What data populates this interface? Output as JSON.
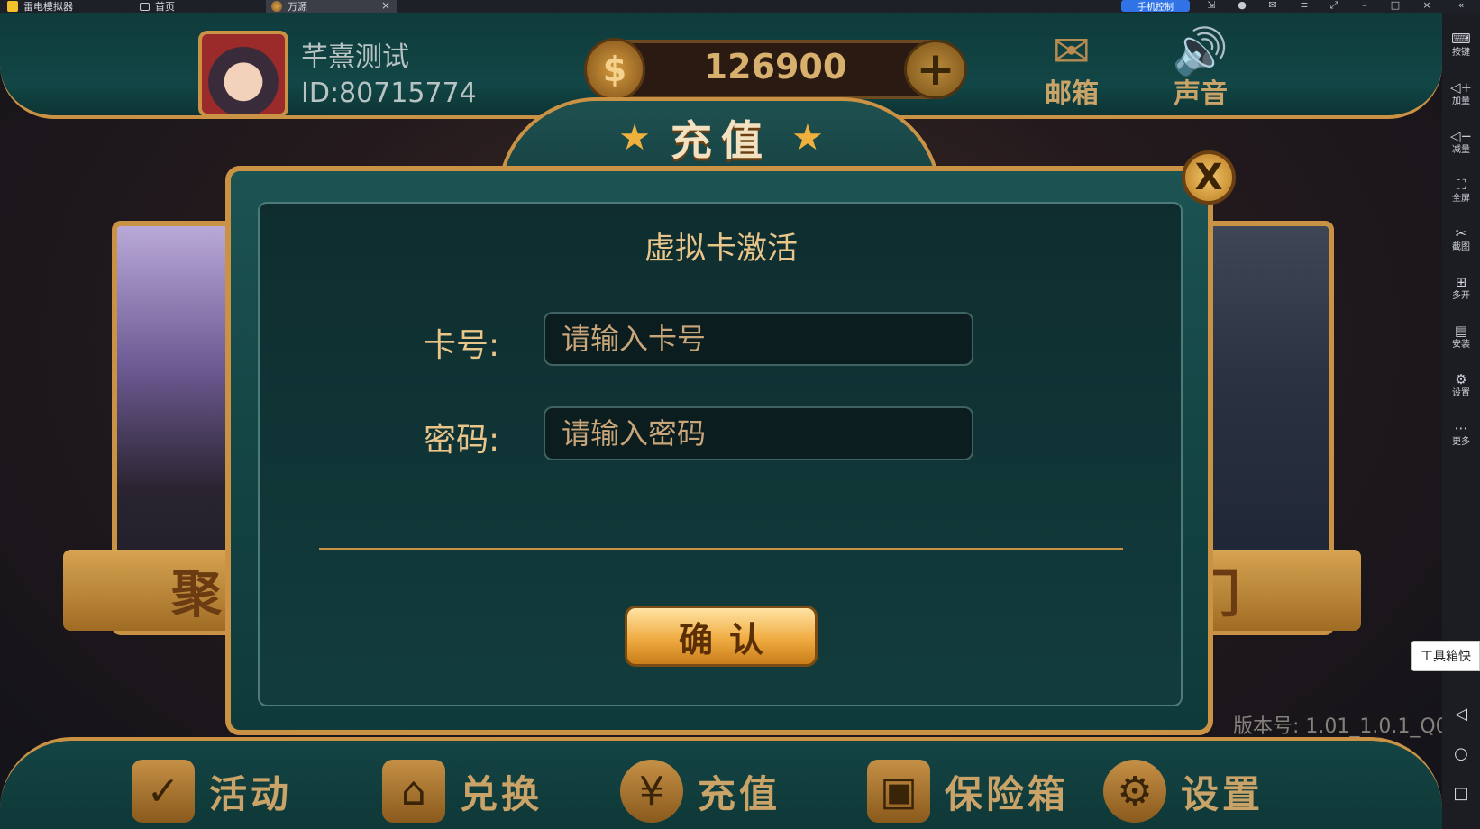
{
  "emulator": {
    "tabs": [
      {
        "label": "雷电模拟器",
        "icon": "emulator-logo-icon"
      },
      {
        "label": "首页",
        "icon": "home-icon"
      },
      {
        "label": "万源",
        "icon": "game-icon"
      }
    ],
    "phone_control": "手机控制",
    "toolbar": [
      {
        "label": "按键",
        "icon": "keyboard-icon"
      },
      {
        "label": "加量",
        "icon": "volume-up-icon"
      },
      {
        "label": "减量",
        "icon": "volume-down-icon"
      },
      {
        "label": "全屏",
        "icon": "fullscreen-icon"
      },
      {
        "label": "截图",
        "icon": "scissors-icon"
      },
      {
        "label": "多开",
        "icon": "multi-instance-icon"
      },
      {
        "label": "安装",
        "icon": "apk-icon"
      },
      {
        "label": "设置",
        "icon": "gear-icon"
      },
      {
        "label": "更多",
        "icon": "more-icon"
      }
    ],
    "toolbox_tip": "工具箱快"
  },
  "game": {
    "user": {
      "name": "芊熹测试",
      "id": "ID:80715774"
    },
    "coins": "126900",
    "top_buttons": {
      "mail": "邮箱",
      "sound": "声音"
    },
    "dialog": {
      "title": "充值",
      "close_label": "X",
      "section_title": "虚拟卡激活",
      "card_label": "卡号:",
      "card_placeholder": "请输入卡号",
      "password_label": "密码:",
      "password_placeholder": "请输入密码",
      "confirm_label": "确认"
    },
    "ribbons": {
      "left": "聚",
      "right": "门"
    },
    "version": "版本号: 1.01_1.0.1_Q0",
    "bottom_nav": {
      "activity": "活动",
      "exchange": "兑换",
      "recharge": "充值",
      "safe": "保险箱",
      "settings": "设置"
    }
  },
  "colors": {
    "gold": "#c99244",
    "teal": "#134242",
    "accent_text": "#e9c589"
  }
}
